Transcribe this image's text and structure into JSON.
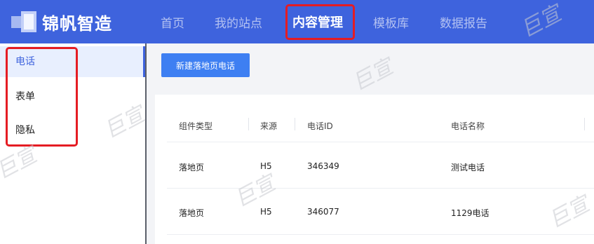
{
  "brand": {
    "name": "锦帆智造"
  },
  "nav": {
    "items": [
      {
        "label": "首页"
      },
      {
        "label": "我的站点"
      },
      {
        "label": "内容管理"
      },
      {
        "label": "模板库"
      },
      {
        "label": "数据报告"
      }
    ],
    "active": "内容管理"
  },
  "sidebar": {
    "items": [
      {
        "label": "电话"
      },
      {
        "label": "表单"
      },
      {
        "label": "隐私"
      }
    ],
    "active": "电话"
  },
  "toolbar": {
    "create_label": "新建落地页电话"
  },
  "table": {
    "headers": [
      "组件类型",
      "来源",
      "电话ID",
      "电话名称"
    ],
    "rows": [
      [
        "落地页",
        "H5",
        "346349",
        "测试电话"
      ],
      [
        "落地页",
        "H5",
        "346077",
        "1129电话"
      ]
    ]
  },
  "watermark": {
    "text": "巨宣"
  },
  "colors": {
    "topbar": "#3e63dd",
    "primary": "#3e7ff2",
    "highlight": "#e51c23"
  }
}
